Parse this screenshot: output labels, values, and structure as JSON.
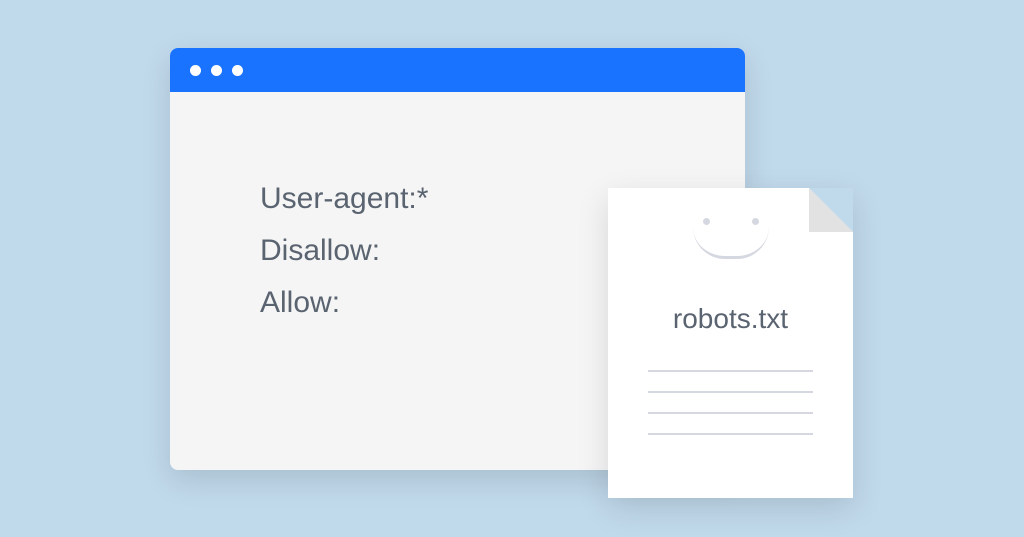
{
  "browser": {
    "content": {
      "line1": "User-agent:*",
      "line2": "Disallow:",
      "line3": "Allow:"
    }
  },
  "file": {
    "label": "robots.txt"
  }
}
